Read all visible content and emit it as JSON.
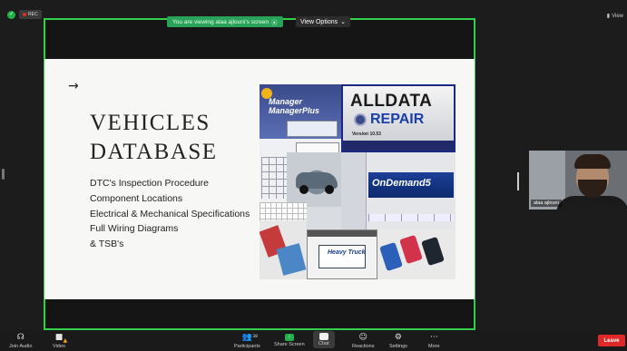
{
  "app": {
    "rec_label": "REC",
    "viewing_banner": "You are viewing alaa ajlouni's screen",
    "view_options": "View Options",
    "view_corner": "View"
  },
  "slide": {
    "arrow": "→",
    "title_line1": "VEHICLES",
    "title_line2": "DATABASE",
    "bullets": [
      "DTC's Inspection Procedure",
      "Component Locations",
      "Electrical & Mechanical Specifications",
      "Full Wiring  Diagrams",
      "& TSB's"
    ]
  },
  "collage": {
    "manager": "Manager ManagerPlus",
    "alldata_1": "ALLDATA",
    "alldata_2": "REPAIR",
    "alldata_version": "Version 10.53",
    "ondemand": "OnDemand5",
    "heavy_truck": "Heavy Truck"
  },
  "participant": {
    "name": "alaa ajlouni"
  },
  "toolbar": {
    "join_audio": "Join Audio",
    "video": "Video",
    "participants": "Participants",
    "participants_count": "38",
    "share_screen": "Share Screen",
    "chat": "Chat",
    "reactions": "Reactions",
    "settings": "Settings",
    "more": "More",
    "leave": "Leave"
  },
  "colors": {
    "share_border": "#33d14a",
    "viewing_banner": "#29a35a",
    "leave": "#e02828"
  }
}
